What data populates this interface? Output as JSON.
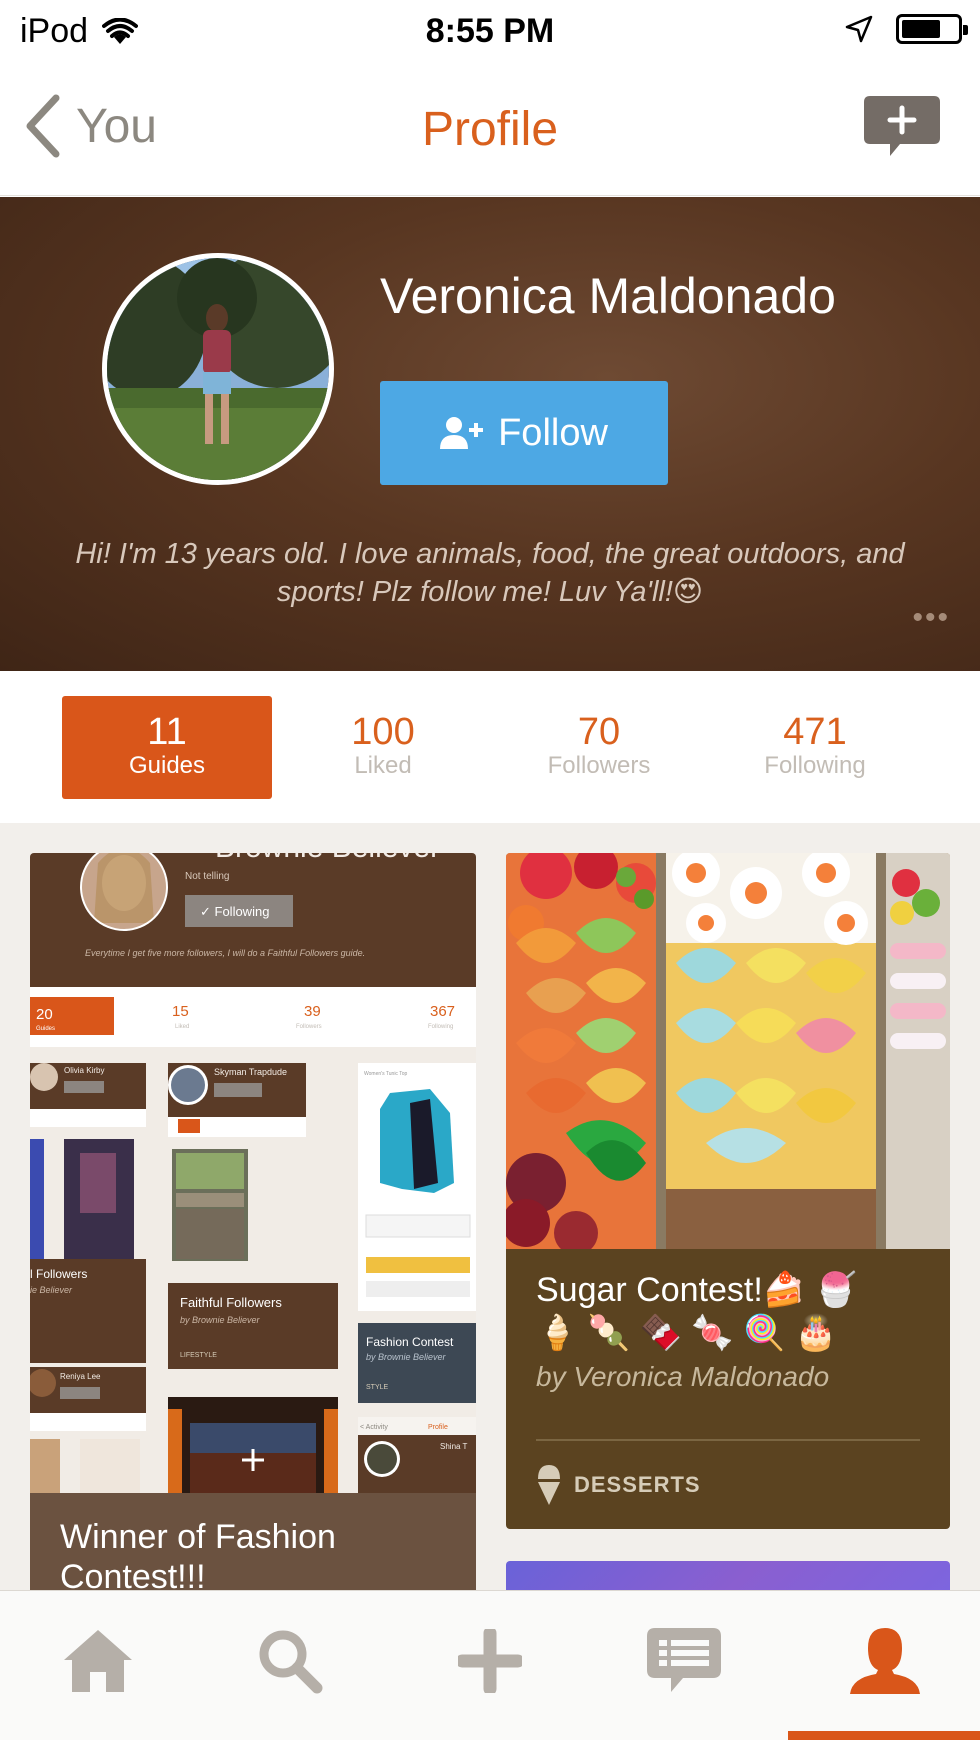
{
  "status_bar": {
    "carrier": "iPod",
    "time": "8:55 PM"
  },
  "nav": {
    "back_label": "You",
    "title": "Profile"
  },
  "profile": {
    "name": "Veronica Maldonado",
    "follow_label": "Follow",
    "bio": "Hi! I'm 13 years old. I love animals, food, the great outdoors, and sports! Plz follow me! Luv Ya'll!😍",
    "more": "•••"
  },
  "stats": [
    {
      "value": "11",
      "label": "Guides",
      "active": true
    },
    {
      "value": "100",
      "label": "Liked",
      "active": false
    },
    {
      "value": "70",
      "label": "Followers",
      "active": false
    },
    {
      "value": "471",
      "label": "Following",
      "active": false
    }
  ],
  "guides": [
    {
      "title": "Winner of Fashion Contest!!!",
      "screenshot": {
        "name": "Brownie Believer",
        "status": "Not telling",
        "following_label": "✓ Following",
        "bio": "Everytime I get five more followers, I will do a Faithful Followers guide.",
        "stats": [
          {
            "value": "20",
            "label": "Guides"
          },
          {
            "value": "15",
            "label": "Liked"
          },
          {
            "value": "39",
            "label": "Followers"
          },
          {
            "value": "367",
            "label": "Following"
          }
        ],
        "tiles": {
          "olivia": "Olivia Kirby",
          "skyman": "Skyman Trapdude",
          "followers_title": "l Followers",
          "followers_by": "ie Believer",
          "faithful_title": "Faithful Followers",
          "faithful_by": "by Brownie Believer",
          "lifestyle": "LIFESTYLE",
          "fashion_title": "Fashion Contest",
          "fashion_by": "by Brownie Believer",
          "style": "STYLE",
          "reniya": "Reniya Lee",
          "activity": "< Activity",
          "profile": "Profile",
          "shina": "Shina T"
        }
      }
    },
    {
      "title": "Sugar Contest!🍰 🍧",
      "emoji_line": "🍦 🍡 🍫 🍬 🍭 🎂",
      "author": "by Veronica Maldonado",
      "category": "DESSERTS"
    }
  ],
  "colors": {
    "accent": "#d9601d",
    "follow_blue": "#4da8e4",
    "header_brown": "#583621",
    "card_brown": "#5b4320"
  },
  "tabs": [
    {
      "icon": "home-icon",
      "active": false
    },
    {
      "icon": "search-icon",
      "active": false
    },
    {
      "icon": "plus-icon",
      "active": false
    },
    {
      "icon": "messages-icon",
      "active": false
    },
    {
      "icon": "profile-icon",
      "active": true
    }
  ]
}
